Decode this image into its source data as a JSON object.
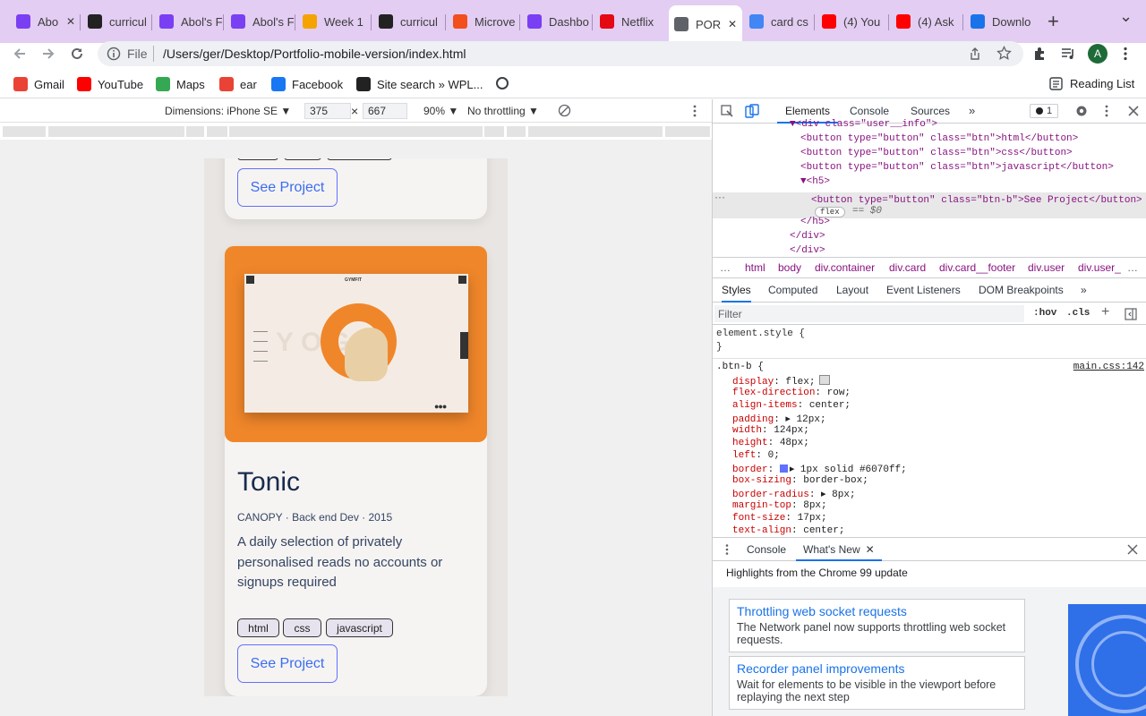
{
  "tabs": [
    {
      "label": "Abo",
      "icon": "m-logo-icon",
      "color": "#7a3ff2"
    },
    {
      "label": "curricul",
      "icon": "github-icon",
      "color": "#222"
    },
    {
      "label": "Abol's F",
      "icon": "m-logo-icon",
      "color": "#7a3ff2"
    },
    {
      "label": "Abol's F",
      "icon": "m-logo-icon",
      "color": "#7a3ff2"
    },
    {
      "label": "Week 1",
      "icon": "pinwheel-icon",
      "color": "#f4a300"
    },
    {
      "label": "curricul",
      "icon": "github-icon",
      "color": "#222"
    },
    {
      "label": "Microve",
      "icon": "figma-icon",
      "color": "#f24e1e"
    },
    {
      "label": "Dashbo",
      "icon": "m-logo-icon",
      "color": "#7a3ff2"
    },
    {
      "label": "Netflix",
      "icon": "netflix-icon",
      "color": "#e50914"
    },
    {
      "label": "POR",
      "icon": "globe-icon",
      "color": "#5f6368"
    },
    {
      "label": "card cs",
      "icon": "google-icon",
      "color": "#4285f4"
    },
    {
      "label": "(4) You",
      "icon": "youtube-icon",
      "color": "#ff0000"
    },
    {
      "label": "(4) Ask",
      "icon": "youtube-icon",
      "color": "#ff0000"
    },
    {
      "label": "Downlo",
      "icon": "download-icon",
      "color": "#1a73e8"
    }
  ],
  "omnibox": {
    "prefix": "File",
    "url": "/Users/ger/Desktop/Portfolio-mobile-version/index.html",
    "avatar": "A"
  },
  "bookmarks": [
    {
      "label": "Gmail",
      "icon": "gmail-icon",
      "color": "#ea4335"
    },
    {
      "label": "YouTube",
      "icon": "youtube-icon",
      "color": "#ff0000"
    },
    {
      "label": "Maps",
      "icon": "maps-icon",
      "color": "#34a853"
    },
    {
      "label": "ear",
      "icon": "gmail-icon",
      "color": "#ea4335"
    },
    {
      "label": "Facebook",
      "icon": "facebook-icon",
      "color": "#1877f2"
    },
    {
      "label": "Site search » WPL...",
      "icon": "wpl-icon",
      "color": "#222"
    }
  ],
  "reading_list": "Reading List",
  "device": {
    "label": "Dimensions: iPhone SE ▼",
    "width": "375",
    "height": "667",
    "zoom": "90% ▼",
    "throttle": "No throttling ▼"
  },
  "card": {
    "title": "Tonic",
    "meta": "CANOPY · Back end Dev · 2015",
    "desc": "A daily selection of privately personalised reads no accounts or signups required",
    "tags": [
      "html",
      "css",
      "javascript"
    ],
    "button": "See Project",
    "image_brand": "GYMFIT",
    "image_word": "YOGA"
  },
  "devtools": {
    "tabs": [
      "Elements",
      "Console",
      "Sources",
      "»"
    ],
    "issues": "1",
    "dom": [
      {
        "indent": 0,
        "html": "▼<div class=\"user__info\">"
      },
      {
        "indent": 1,
        "html": "<button type=\"button\" class=\"btn\">html</button>"
      },
      {
        "indent": 1,
        "html": "<button type=\"button\" class=\"btn\">css</button>"
      },
      {
        "indent": 1,
        "html": "<button type=\"button\" class=\"btn\">javascript</button>"
      },
      {
        "indent": 1,
        "html": "▼<h5>"
      },
      {
        "indent": 2,
        "html": "<button type=\"button\" class=\"btn-b\">See Project</button>"
      },
      {
        "indent": 1,
        "html": "</h5>"
      },
      {
        "indent": 0,
        "html": "</div>"
      },
      {
        "indent": 0,
        "html": "</div>"
      }
    ],
    "flex_badge": "flex",
    "eq": "== $0",
    "breadcrumbs": [
      "html",
      "body",
      "div.container",
      "div.card",
      "div.card__footer",
      "div.user",
      "div.user_"
    ],
    "style_tabs": [
      "Styles",
      "Computed",
      "Layout",
      "Event Listeners",
      "DOM Breakpoints",
      "»"
    ],
    "filter_placeholder": "Filter",
    "hov": ":hov",
    "cls": ".cls",
    "element_style": "element.style {",
    "close_brace": "}",
    "selector": ".btn-b {",
    "source": "main.css:142",
    "rules": [
      {
        "p": "display",
        "v": "flex;"
      },
      {
        "p": "flex-direction",
        "v": "row;"
      },
      {
        "p": "align-items",
        "v": "center;"
      },
      {
        "p": "padding",
        "v": "▸ 12px;"
      },
      {
        "p": "width",
        "v": "124px;"
      },
      {
        "p": "height",
        "v": "48px;"
      },
      {
        "p": "left",
        "v": "0;"
      },
      {
        "p": "border",
        "v": "▸ 1px solid #6070ff;"
      },
      {
        "p": "box-sizing",
        "v": "border-box;"
      },
      {
        "p": "border-radius",
        "v": "▸ 8px;"
      },
      {
        "p": "margin-top",
        "v": "8px;"
      },
      {
        "p": "font-size",
        "v": "17px;"
      },
      {
        "p": "text-align",
        "v": "center;"
      }
    ],
    "drawer_tabs": [
      "Console",
      "What's New"
    ],
    "drawer_heading": "Highlights from the Chrome 99 update",
    "news": [
      {
        "title": "Throttling web socket requests",
        "body": "The Network panel now supports throttling web socket requests."
      },
      {
        "title": "Recorder panel improvements",
        "body": "Wait for elements to be visible in the viewport before replaying the next step"
      }
    ]
  }
}
